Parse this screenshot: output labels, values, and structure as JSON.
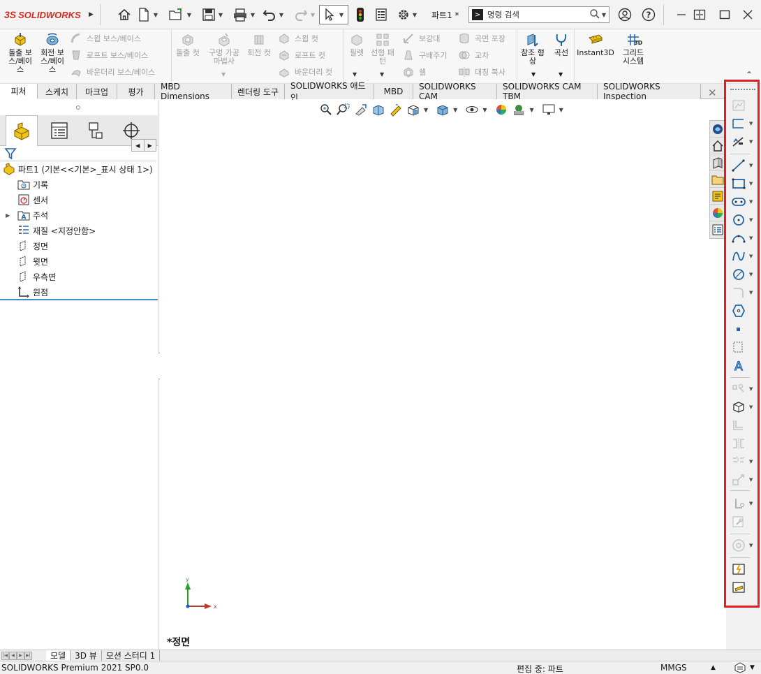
{
  "app": {
    "logo_text": "SOLIDWORKS",
    "logo_mark": "3S"
  },
  "titlebar": {
    "doc_title": "파트1 *",
    "search_placeholder": "명령 검색"
  },
  "command_manager": {
    "extruded_boss": "돌출 보스/베이스",
    "revolved_boss": "회전 보스/베이스",
    "swept_boss": "스윕 보스/베이스",
    "lofted_boss": "로프트 보스/베이스",
    "boundary_boss": "바운더리 보스/베이스",
    "extruded_cut": "돌출 컷",
    "hole_wizard": "구멍 가공 마법사",
    "revolved_cut": "회전 컷",
    "swept_cut": "스윕 컷",
    "lofted_cut": "로프트 컷",
    "boundary_cut": "바운더리 컷",
    "fillet": "필렛",
    "linear_pattern": "선형 패턴",
    "rib": "보강대",
    "draft": "구배주기",
    "shell": "쉘",
    "wrap": "곡면 포장",
    "intersect": "교차",
    "mirror": "대칭 복사",
    "reference_geometry": "참조 형상",
    "curves": "곡선",
    "instant3d": "Instant3D",
    "grid_system": "그리드 시스템",
    "grid_badge": "3D"
  },
  "tabs": [
    {
      "label": "피처",
      "active": true
    },
    {
      "label": "스케치",
      "active": false
    },
    {
      "label": "마크업",
      "active": false
    },
    {
      "label": "평가",
      "active": false
    },
    {
      "label": "MBD Dimensions",
      "active": false
    },
    {
      "label": "렌더링 도구",
      "active": false
    },
    {
      "label": "SOLIDWORKS 애드인",
      "active": false
    },
    {
      "label": "MBD",
      "active": false
    },
    {
      "label": "SOLIDWORKS CAM",
      "active": false
    },
    {
      "label": "SOLIDWORKS CAM TBM",
      "active": false
    },
    {
      "label": "SOLIDWORKS Inspection",
      "active": false
    }
  ],
  "tree": {
    "root": "파트1  (기본<<기본>_표시 상태 1>)",
    "items": [
      "기록",
      "센서",
      "주석",
      "재질 <지정안함>",
      "정면",
      "윗면",
      "우측면",
      "원점"
    ]
  },
  "viewport": {
    "view_name": "*정면",
    "axis_x": "x",
    "axis_y": "y"
  },
  "bottom_tabs": [
    "모델",
    "3D 뷰",
    "모션 스터디 1"
  ],
  "status": {
    "product": "SOLIDWORKS Premium 2021 SP0.0",
    "editing": "편집 중: 파트",
    "units": "MMGS"
  },
  "colors": {
    "highlight": "#e01e24",
    "brand": "#d52b1e",
    "tree_line": "#3d8ec7"
  }
}
